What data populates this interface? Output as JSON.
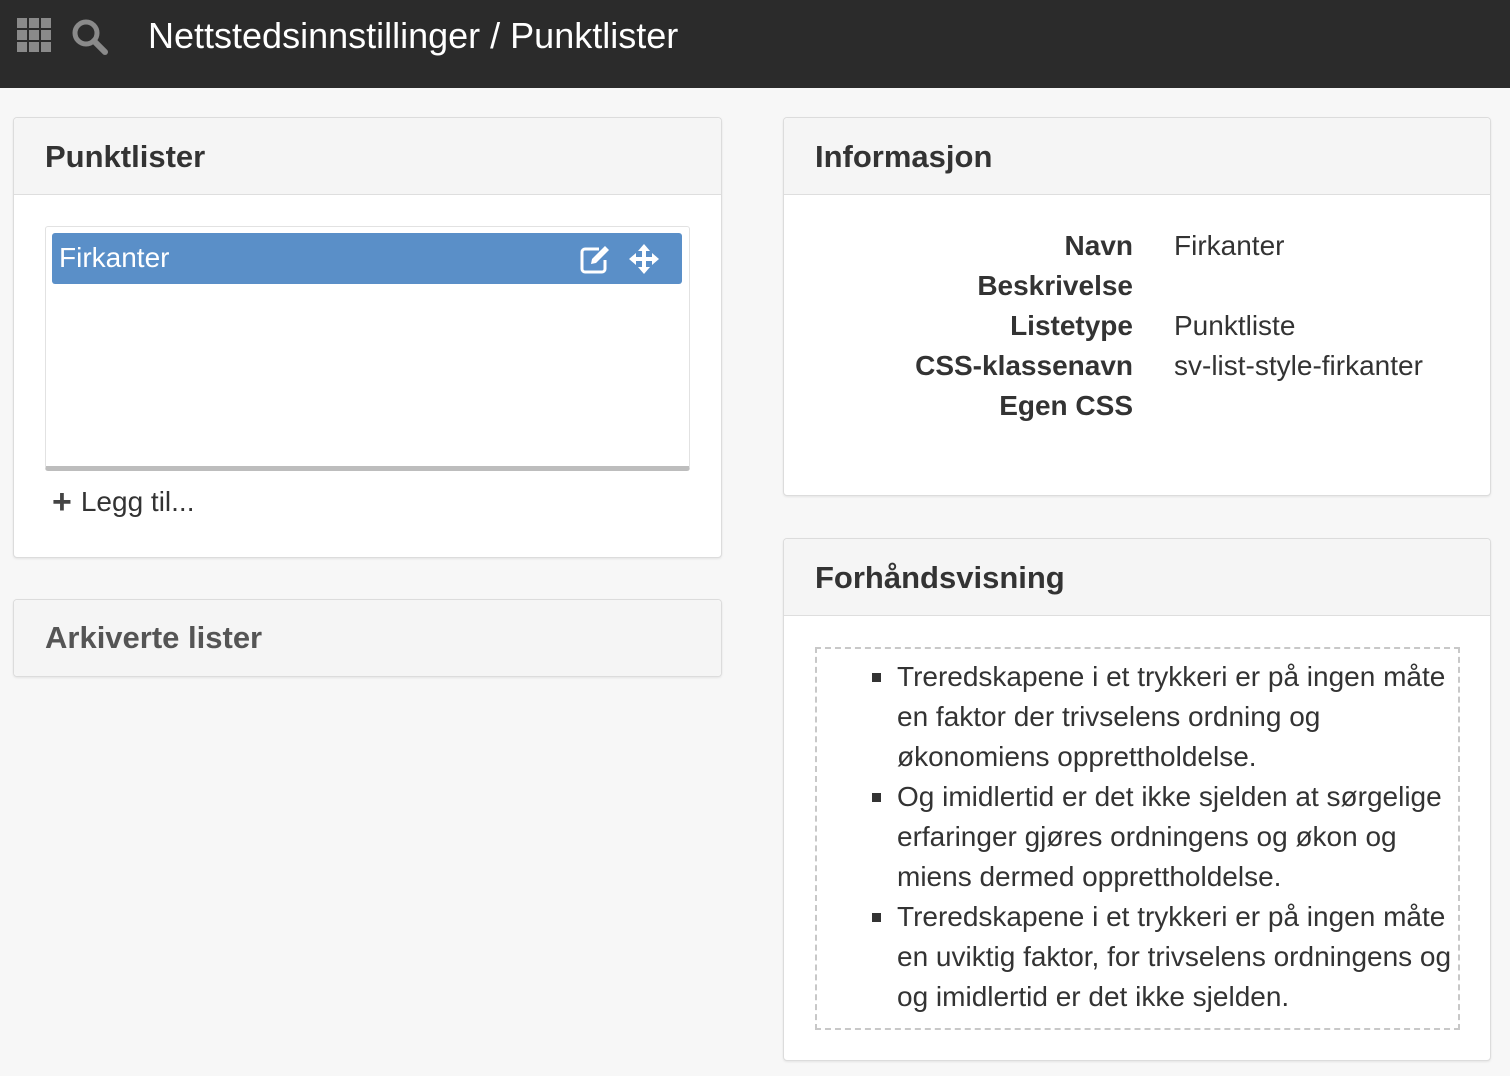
{
  "header": {
    "title": "Nettstedsinnstillinger / Punktlister",
    "apps_icon": "apps-grid-icon",
    "search_icon": "search-icon"
  },
  "lists_panel": {
    "title": "Punktlister",
    "items": [
      {
        "label": "Firkanter",
        "selected": true,
        "icons": [
          "edit-icon",
          "move-icon"
        ]
      }
    ],
    "add_label": "Legg til..."
  },
  "archive_panel": {
    "title": "Arkiverte lister"
  },
  "info_panel": {
    "title": "Informasjon",
    "rows": [
      {
        "label": "Navn",
        "value": "Firkanter"
      },
      {
        "label": "Beskrivelse",
        "value": ""
      },
      {
        "label": "Listetype",
        "value": "Punktliste"
      },
      {
        "label": "CSS-klassenavn",
        "value": "sv-list-style-firkanter"
      },
      {
        "label": "Egen CSS",
        "value": ""
      }
    ]
  },
  "preview_panel": {
    "title": "Forhåndsvisning",
    "items": [
      {
        "lines": [
          "Treredskapene i et trykkeri er på ingen måte",
          "en faktor der trivselens ordning og",
          "økonomiens opprettholdelse."
        ]
      },
      {
        "lines": [
          "Og imidlertid er det ikke sjelden at sørgelige",
          "erfaringer gjøres ordningens og økon og",
          "miens dermed opprettholdelse."
        ]
      },
      {
        "lines": [
          "Treredskapene i et trykkeri er på ingen måte",
          "en uviktig faktor, for trivselens ordningens og",
          "og imidlertid er det ikke sjelden."
        ]
      }
    ]
  },
  "colors": {
    "topbar": "#2b2b2b",
    "selected_item": "#5a8fc8",
    "panel_header": "#f5f5f5"
  }
}
